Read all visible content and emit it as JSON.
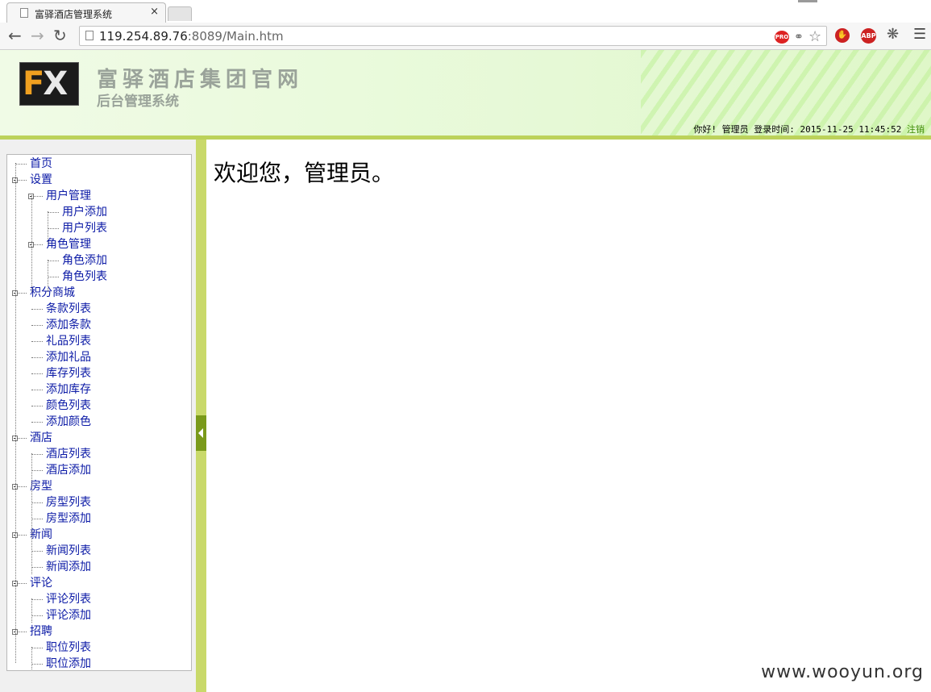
{
  "browser": {
    "tab_title": "富驿酒店管理系统",
    "tab_close": "×",
    "url_host": "119.254.89.76",
    "url_rest": ":8089/Main.htm",
    "extensions": {
      "pro_label": "PRO",
      "abp_label": "ABP"
    }
  },
  "header": {
    "logo_f": "F",
    "logo_x": "X",
    "site_title": "富驿酒店集团官网",
    "site_subtitle": "后台管理系统",
    "greeting": "你好! 管理员 登录时间:",
    "login_time": "2015-11-25 11:45:52",
    "logout": "注销"
  },
  "tree": [
    {
      "label": "首页",
      "level": 0,
      "toggle": false
    },
    {
      "label": "设置",
      "level": 0,
      "toggle": true
    },
    {
      "label": "用户管理",
      "level": 1,
      "toggle": true
    },
    {
      "label": "用户添加",
      "level": 2,
      "toggle": false
    },
    {
      "label": "用户列表",
      "level": 2,
      "toggle": false
    },
    {
      "label": "角色管理",
      "level": 1,
      "toggle": true
    },
    {
      "label": "角色添加",
      "level": 2,
      "toggle": false
    },
    {
      "label": "角色列表",
      "level": 2,
      "toggle": false
    },
    {
      "label": "积分商城",
      "level": 0,
      "toggle": true
    },
    {
      "label": "条款列表",
      "level": 1,
      "toggle": false
    },
    {
      "label": "添加条款",
      "level": 1,
      "toggle": false
    },
    {
      "label": "礼品列表",
      "level": 1,
      "toggle": false
    },
    {
      "label": "添加礼品",
      "level": 1,
      "toggle": false
    },
    {
      "label": "库存列表",
      "level": 1,
      "toggle": false
    },
    {
      "label": "添加库存",
      "level": 1,
      "toggle": false
    },
    {
      "label": "颜色列表",
      "level": 1,
      "toggle": false
    },
    {
      "label": "添加颜色",
      "level": 1,
      "toggle": false
    },
    {
      "label": "酒店",
      "level": 0,
      "toggle": true
    },
    {
      "label": "酒店列表",
      "level": 1,
      "toggle": false
    },
    {
      "label": "酒店添加",
      "level": 1,
      "toggle": false
    },
    {
      "label": "房型",
      "level": 0,
      "toggle": true
    },
    {
      "label": "房型列表",
      "level": 1,
      "toggle": false
    },
    {
      "label": "房型添加",
      "level": 1,
      "toggle": false
    },
    {
      "label": "新闻",
      "level": 0,
      "toggle": true
    },
    {
      "label": "新闻列表",
      "level": 1,
      "toggle": false
    },
    {
      "label": "新闻添加",
      "level": 1,
      "toggle": false
    },
    {
      "label": "评论",
      "level": 0,
      "toggle": true
    },
    {
      "label": "评论列表",
      "level": 1,
      "toggle": false
    },
    {
      "label": "评论添加",
      "level": 1,
      "toggle": false
    },
    {
      "label": "招聘",
      "level": 0,
      "toggle": true
    },
    {
      "label": "职位列表",
      "level": 1,
      "toggle": false
    },
    {
      "label": "职位添加",
      "level": 1,
      "toggle": false
    }
  ],
  "main": {
    "welcome": "欢迎您，管理员。"
  },
  "watermark": "www.wooyun.org",
  "colors": {
    "accent_green": "#bcd25a",
    "tree_link": "#0b1aa6",
    "logout_link": "#3a8a00"
  }
}
